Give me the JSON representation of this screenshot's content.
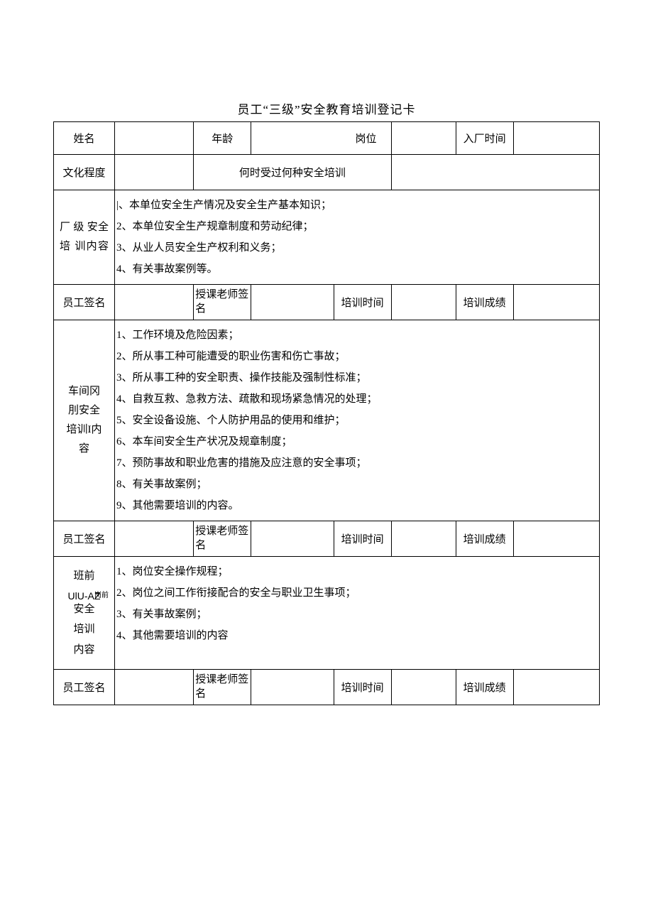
{
  "title": "员工“三级”安全教育培训登记卡",
  "labels": {
    "name": "姓名",
    "age": "年龄",
    "position": "岗位",
    "entry_time": "入厂时间",
    "education": "文化程度",
    "prior_training": "何时受过何种安全培训",
    "emp_sign": "员工签名",
    "teacher_sign": "授课老师签名",
    "train_time": "培训时间",
    "train_score": "培训成绩",
    "factory_level": "厂 级 安全 培 训内容",
    "workshop_level": "车间冈刖安全培训I内容",
    "pre_shift_level_line1": "班前",
    "pre_shift_level_line2a": "UlU-AZ",
    "pre_shift_level_line2b": "岗前",
    "pre_shift_level_line3": "安全",
    "pre_shift_level_line4": "培训",
    "pre_shift_level_line5": "内容"
  },
  "factory_content": "|、本单位安全生产情况及安全生产基本知识；\n2、本单位安全生产规章制度和劳动纪律；\n3、从业人员安全生产权利和义务；\n4、有关事故案例等。",
  "workshop_content": "1、工作环境及危险因素；\n2、所从事工种可能遭受的职业伤害和伤亡事故；\n3、所从事工种的安全职责、操作技能及强制性标准；\n4、自救互救、急救方法、疏散和现场紧急情况的处理；\n5、安全设备设施、个人防护用品的使用和维护；\n6、本车间安全生产状况及规章制度；\n7、预防事故和职业危害的措施及应注意的安全事项；\n8、有关事故案例；\n9、其他需要培训的内容。",
  "preshift_content": "1、岗位安全操作规程；\n2、岗位之间工作衔接配合的安全与职业卫生事项；\n3、有关事故案例；\n4、其他需要培训的内容"
}
